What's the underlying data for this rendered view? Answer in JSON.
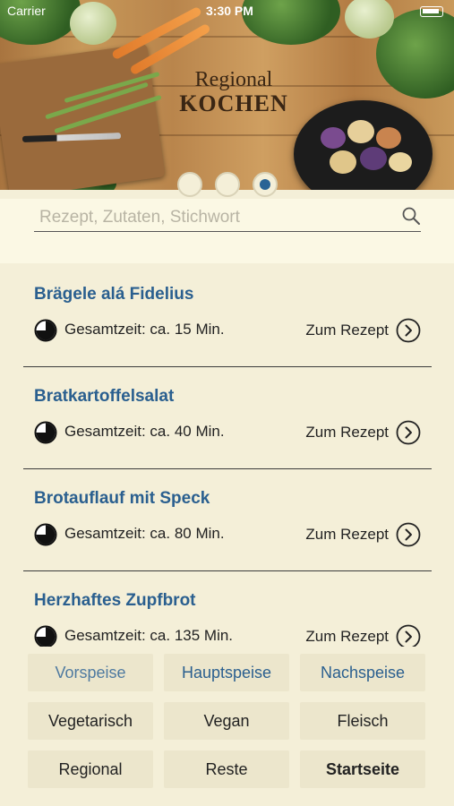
{
  "status": {
    "carrier": "Carrier",
    "time": "3:30 PM"
  },
  "hero": {
    "logo_line1": "Regional",
    "logo_line2": "KOCHEN",
    "pager": {
      "count": 3,
      "active": 3
    }
  },
  "search": {
    "placeholder": "Rezept, Zutaten, Stichwort",
    "value": ""
  },
  "recipes": [
    {
      "title": "Brägele alá Fidelius",
      "time": "Gesamtzeit: ca. 15 Min.",
      "link": "Zum Rezept"
    },
    {
      "title": "Bratkartoffelsalat",
      "time": "Gesamtzeit: ca. 40 Min.",
      "link": "Zum Rezept"
    },
    {
      "title": "Brotauflauf mit Speck",
      "time": "Gesamtzeit: ca. 80 Min.",
      "link": "Zum Rezept"
    },
    {
      "title": "Herzhaftes Zupfbrot",
      "time": "Gesamtzeit: ca. 135 Min.",
      "link": "Zum Rezept"
    }
  ],
  "categories": {
    "vorspeise": "Vorspeise",
    "hauptspeise": "Hauptspeise",
    "nachspeise": "Nachspeise",
    "vegetarisch": "Vegetarisch",
    "vegan": "Vegan",
    "fleisch": "Fleisch",
    "regional": "Regional",
    "reste": "Reste",
    "startseite": "Startseite"
  },
  "colors": {
    "accent": "#2a5f8f",
    "background": "#f4efd8",
    "button": "#ece6cc"
  }
}
